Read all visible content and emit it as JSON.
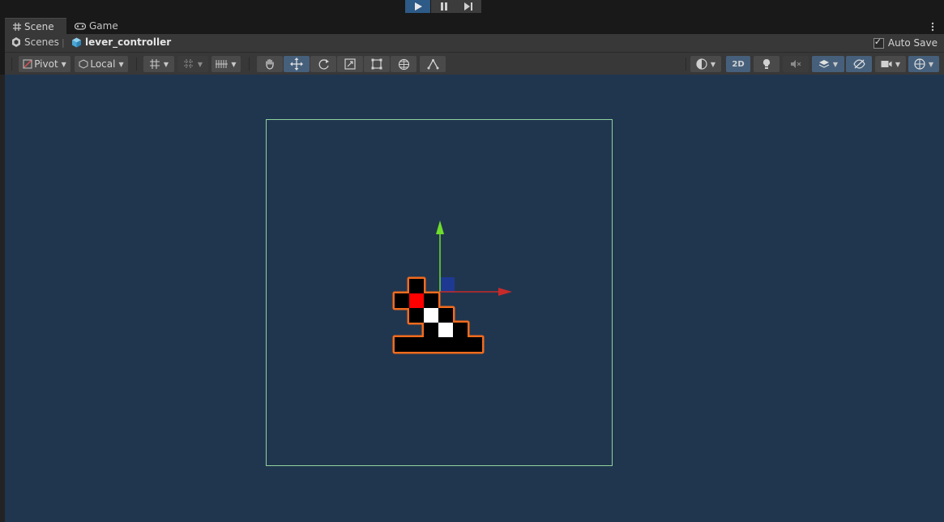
{
  "playbar": {
    "play_icon": "play-icon",
    "pause_icon": "pause-icon",
    "step_icon": "step-icon"
  },
  "tabs": [
    {
      "label": "Scene",
      "icon": "grid-icon"
    },
    {
      "label": "Game",
      "icon": "gamepad-icon"
    }
  ],
  "breadcrumb": {
    "scenes_label": "Scenes",
    "separator": "|",
    "scene_name": "lever_controller"
  },
  "autosave": {
    "label": "Auto Save",
    "checked": true
  },
  "toolbar": {
    "pivot_label": "Pivot",
    "local_label": "Local",
    "mode_2d_label": "2D"
  },
  "colors": {
    "viewport_bg": "#20364f",
    "frame": "#8fd39b",
    "selection_outline": "#f26b1d",
    "x_axis": "#c82a2a",
    "y_axis": "#6fdc2c",
    "accent": "#2d5a86"
  }
}
